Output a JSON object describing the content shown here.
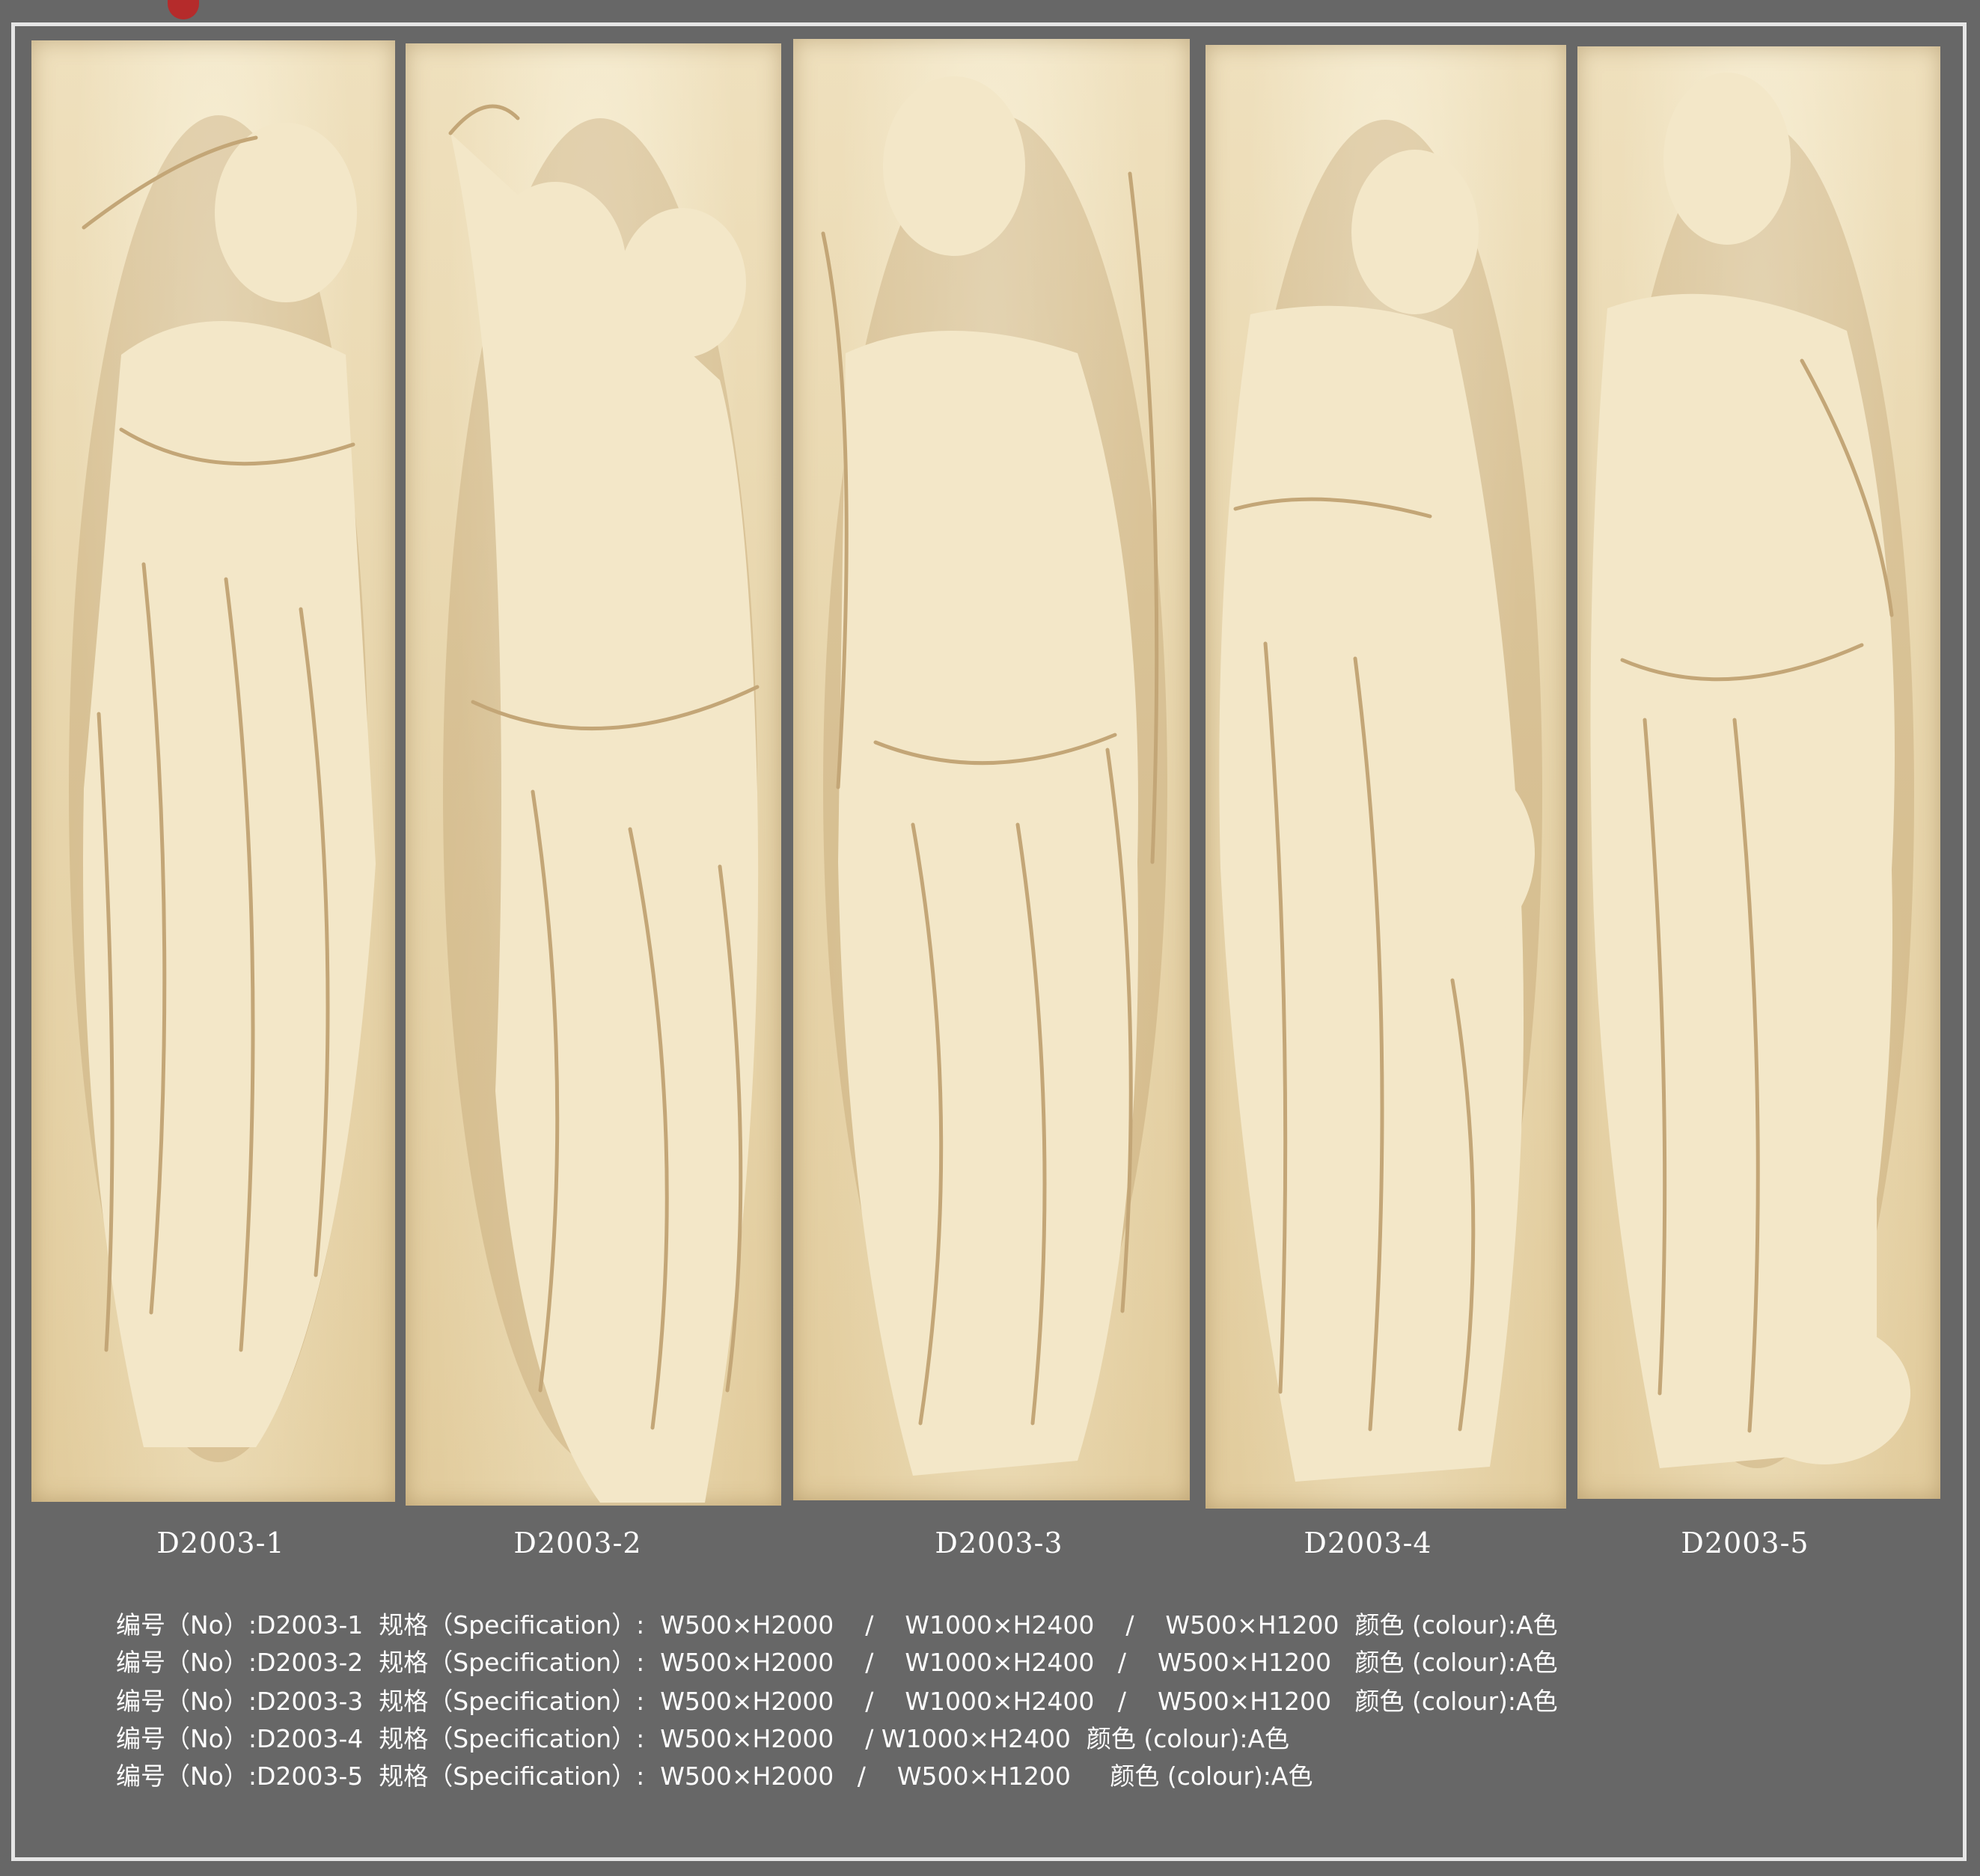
{
  "panels": [
    {
      "name": "relief-panel-1",
      "caption": "D2003-1"
    },
    {
      "name": "relief-panel-2",
      "caption": "D2003-2"
    },
    {
      "name": "relief-panel-3",
      "caption": "D2003-3"
    },
    {
      "name": "relief-panel-4",
      "caption": "D2003-4"
    },
    {
      "name": "relief-panel-5",
      "caption": "D2003-5"
    }
  ],
  "specs": [
    "编号（No）:D2003-1  规格（Specification）:  W500×H2000    /    W1000×H2400    /    W500×H1200  颜色 (colour):A色",
    "编号（No）:D2003-2  规格（Specification）:  W500×H2000    /    W1000×H2400   /    W500×H1200   颜色 (colour):A色",
    "编号（No）:D2003-3  规格（Specification）:  W500×H2000    /    W1000×H2400   /    W500×H1200   颜色 (colour):A色",
    "编号（No）:D2003-4  规格（Specification）:  W500×H2000    / W1000×H2400  颜色 (colour):A色",
    "编号（No）:D2003-5  规格（Specification）:  W500×H2000   /    W500×H1200     颜色 (colour):A色"
  ],
  "colors": {
    "background": "#676767",
    "relief": "#e8d6ad",
    "text": "#ffffff"
  }
}
